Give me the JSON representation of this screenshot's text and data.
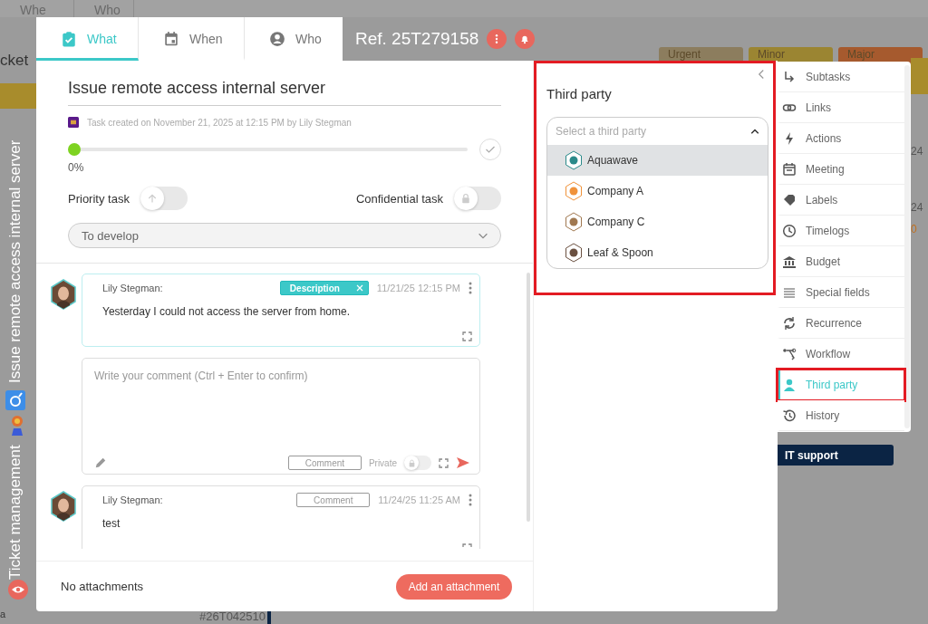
{
  "background": {
    "tabs": [
      "Whe",
      "Who"
    ],
    "page_title": "cket",
    "rows": [
      "a"
    ],
    "priority_tags": [
      {
        "label": "Urgent",
        "color": "#8c7d5e"
      },
      {
        "label": "Minor",
        "color": "#9b8532"
      },
      {
        "label": "Major",
        "color": "#a65a2e"
      }
    ],
    "refs": [
      "24",
      "24"
    ],
    "count": "0",
    "team_tag": "IT support",
    "footer_ref": "#26T042510"
  },
  "breadcrumb": [
    "Ticket management",
    "Issue remote access internal server"
  ],
  "modal": {
    "tabs": [
      {
        "label": "What",
        "selected": true
      },
      {
        "label": "When",
        "selected": false
      },
      {
        "label": "Who",
        "selected": false
      }
    ],
    "ref": "Ref. 25T279158",
    "title": "Issue remote access internal server",
    "created": "Task created on November 21, 2025 at 12:15 PM by Lily Stegman",
    "progress": {
      "level": 0,
      "label": "0%"
    },
    "priority": {
      "label": "Priority task",
      "on": false
    },
    "confidential": {
      "label": "Confidential task",
      "on": false
    },
    "status": "To develop",
    "thread": [
      {
        "kind": "comment",
        "author": "Lily Stegman:",
        "tag": {
          "kind": "description",
          "label": "Description"
        },
        "time": "11/21/25 12:15 PM",
        "text": "Yesterday I could not access the server from home."
      },
      {
        "kind": "composer",
        "placeholder": "Write your comment (Ctrl + Enter to confirm)",
        "type": "Comment",
        "private_label": "Private",
        "private": false
      },
      {
        "kind": "comment",
        "author": "Lily Stegman:",
        "tag": {
          "kind": "comment",
          "label": "Comment"
        },
        "time": "11/24/25 11:25 AM",
        "text": "test"
      }
    ],
    "attachments": "No attachments",
    "add_button": "Add an attachment"
  },
  "third_party": {
    "outlined": true,
    "title": "Third party",
    "select": {
      "placeholder": "Select a third party",
      "expanded": true,
      "options": [
        {
          "label": "Aquawave",
          "selected": true
        },
        {
          "label": "Company A",
          "selected": false
        },
        {
          "label": "Company C",
          "selected": false
        },
        {
          "label": "Leaf & Spoon",
          "selected": false
        }
      ]
    }
  },
  "menu": {
    "items": [
      {
        "label": "Subtasks",
        "selected": false,
        "outlined": false
      },
      {
        "label": "Links",
        "selected": false,
        "outlined": false
      },
      {
        "label": "Actions",
        "selected": false,
        "outlined": false
      },
      {
        "label": "Meeting",
        "selected": false,
        "outlined": false
      },
      {
        "label": "Labels",
        "selected": false,
        "outlined": false
      },
      {
        "label": "Timelogs",
        "selected": false,
        "outlined": false
      },
      {
        "label": "Budget",
        "selected": false,
        "outlined": false
      },
      {
        "label": "Special fields",
        "selected": false,
        "outlined": false
      },
      {
        "label": "Recurrence",
        "selected": false,
        "outlined": false
      },
      {
        "label": "Workflow",
        "selected": false,
        "outlined": false
      },
      {
        "label": "Third party",
        "selected": true,
        "outlined": true
      },
      {
        "label": "History",
        "selected": false,
        "outlined": false
      }
    ]
  }
}
